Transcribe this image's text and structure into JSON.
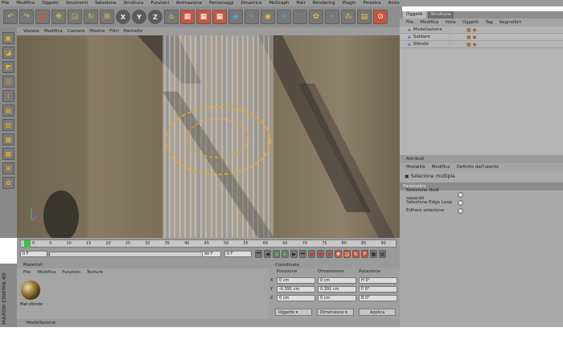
{
  "menu": [
    "File",
    "Modifica",
    "Oggetti",
    "Strumenti",
    "Selezione",
    "Struttura",
    "Funzioni",
    "Animazione",
    "Personaggi",
    "Dinamica",
    "MoGraph",
    "Hair",
    "Rendering",
    "Plugin",
    "Finestra",
    "Aiuto"
  ],
  "viewport_menu": [
    "Visione",
    "Modifica",
    "Camere",
    "Mostra",
    "Filtri",
    "Pannello"
  ],
  "objects_panel": {
    "tabs": [
      "Oggetti",
      "Struttura"
    ],
    "menu": [
      "File",
      "Modifica",
      "Vista",
      "Oggetti",
      "Tag",
      "Segnalibri"
    ],
    "items": [
      {
        "name": "Modellazione"
      },
      {
        "name": "Saldare"
      },
      {
        "name": "Sfondo"
      }
    ]
  },
  "attributes_panel": {
    "title": "Attributi",
    "menu": [
      "Modalità",
      "Modifica",
      "Definito dall'utente"
    ],
    "selection_label": "Selezione multipla",
    "section": "Parametro",
    "options": [
      "Selezione Nodi separati",
      "Seleziona Edge Loop",
      "Editare selezione"
    ]
  },
  "timeline": {
    "ticks": [
      "0",
      "5",
      "10",
      "15",
      "20",
      "25",
      "30",
      "35",
      "40",
      "45",
      "50",
      "55",
      "60",
      "65",
      "70",
      "75",
      "80",
      "85",
      "90"
    ],
    "current_frame": "0 F",
    "end_frame": "90 F",
    "start_field": "0 F",
    "end_field": "90 F"
  },
  "materials_panel": {
    "title": "Materiali",
    "menu": [
      "File",
      "Modifica",
      "Funzioni",
      "Texture"
    ],
    "material_name": "Mat.sfondo"
  },
  "coords_panel": {
    "title": "Coordinate",
    "headers": [
      "Posizione",
      "Dimensione",
      "Rotazione"
    ],
    "rows": [
      {
        "axis": "X",
        "pos": "0 cm",
        "size": "0 cm",
        "rot": "H 0°"
      },
      {
        "axis": "Y",
        "pos": "-0.391 cm",
        "size": "0.391 cm",
        "rot": "P 0°"
      },
      {
        "axis": "Z",
        "pos": "0 cm",
        "size": "0 cm",
        "rot": "B 0°"
      }
    ],
    "mode_select": "Oggetto",
    "size_select": "Dimensione",
    "apply_button": "Applica"
  },
  "status": "Modellazione",
  "brand": "MAXON CINEMA 4D",
  "colors": {
    "panel": "#8d8d8d",
    "highlight": "#c9553a",
    "selection": "#f0b020"
  }
}
